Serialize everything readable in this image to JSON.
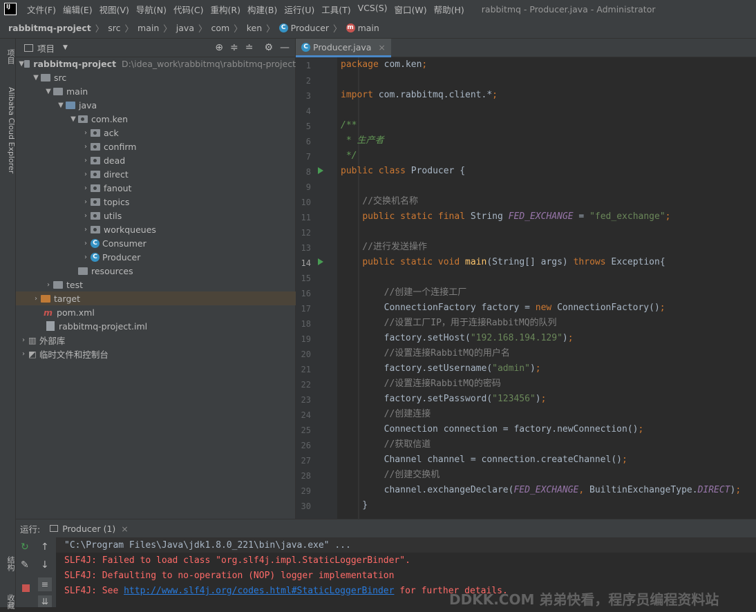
{
  "titlebar": {
    "menus": [
      "文件(F)",
      "编辑(E)",
      "视图(V)",
      "导航(N)",
      "代码(C)",
      "重构(R)",
      "构建(B)",
      "运行(U)",
      "工具(T)",
      "VCS(S)",
      "窗口(W)",
      "帮助(H)"
    ],
    "title": "rabbitmq - Producer.java - Administrator"
  },
  "breadcrumb": [
    "rabbitmq-project",
    "src",
    "main",
    "java",
    "com",
    "ken",
    "Producer",
    "main"
  ],
  "leftstrip": {
    "project": "项目",
    "cloud": "Alibaba Cloud Explorer",
    "structure": "结构",
    "bookmarks": "收藏"
  },
  "project": {
    "title": "项目",
    "root": {
      "name": "rabbitmq-project",
      "path": "D:\\idea_work\\rabbitmq\\rabbitmq-project"
    },
    "src": "src",
    "main": "main",
    "java": "java",
    "pkg": "com.ken",
    "subpkgs": [
      "ack",
      "confirm",
      "dead",
      "direct",
      "fanout",
      "topics",
      "utils",
      "workqueues"
    ],
    "classes": [
      "Consumer",
      "Producer"
    ],
    "resources": "resources",
    "test": "test",
    "target": "target",
    "pom": "pom.xml",
    "iml": "rabbitmq-project.iml",
    "ext": "外部库",
    "scratch": "临时文件和控制台"
  },
  "editor": {
    "tab": "Producer.java",
    "lines": [
      "package com.ken;",
      "",
      "import com.rabbitmq.client.*;",
      "",
      "/**",
      " * 生产者",
      " */",
      "public class Producer {",
      "",
      "    //交换机名称",
      "    public static final String FED_EXCHANGE = \"fed_exchange\";",
      "",
      "    //进行发送操作",
      "    public static void main(String[] args) throws Exception{",
      "",
      "        //创建一个连接工厂",
      "        ConnectionFactory factory = new ConnectionFactory();",
      "        //设置工厂IP，用于连接RabbitMQ的队列",
      "        factory.setHost(\"192.168.194.129\");",
      "        //设置连接RabbitMQ的用户名",
      "        factory.setUsername(\"admin\");",
      "        //设置连接RabbitMQ的密码",
      "        factory.setPassword(\"123456\");",
      "        //创建连接",
      "        Connection connection = factory.newConnection();",
      "        //获取信道",
      "        Channel channel = connection.createChannel();",
      "        //创建交换机",
      "        channel.exchangeDeclare(FED_EXCHANGE, BuiltinExchangeType.DIRECT);",
      "    }"
    ]
  },
  "run": {
    "label": "运行:",
    "tab": "Producer (1)",
    "console": [
      "\"C:\\Program Files\\Java\\jdk1.8.0_221\\bin\\java.exe\" ...",
      "SLF4J: Failed to load class \"org.slf4j.impl.StaticLoggerBinder\".",
      "SLF4J: Defaulting to no-operation (NOP) logger implementation"
    ],
    "see": "SLF4J: See ",
    "link": "http://www.slf4j.org/codes.html#StaticLoggerBinder",
    "tail": " for further details."
  },
  "watermark": "DDKK.COM 弟弟快看，程序员编程资料站",
  "colors": {
    "bg": "#2b2b2b",
    "panel": "#3c3f41",
    "keyword": "#cc7832",
    "string": "#6a8759",
    "comment": "#808080",
    "error": "#ff6b68",
    "link": "#287bde"
  }
}
